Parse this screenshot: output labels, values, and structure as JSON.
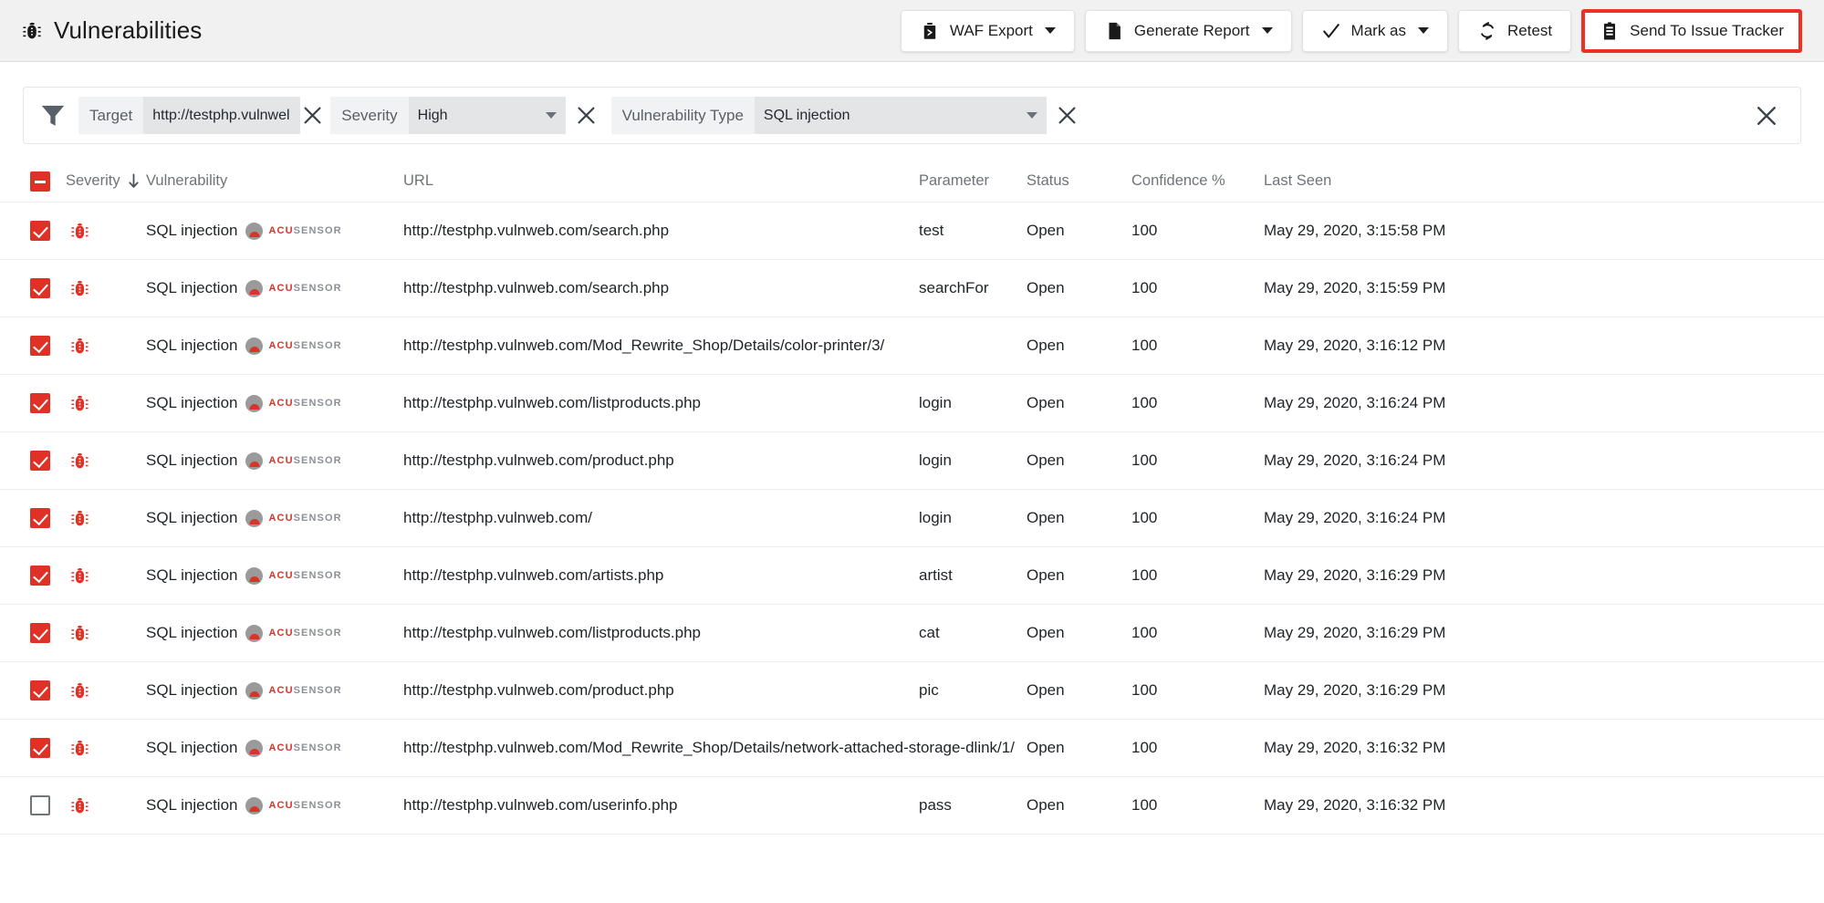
{
  "header": {
    "title": "Vulnerabilities",
    "bug_icon": "bug-icon",
    "toolbar": [
      {
        "label": "WAF Export",
        "icon": "waf-export-icon",
        "has_caret": true,
        "highlighted": false
      },
      {
        "label": "Generate Report",
        "icon": "document-icon",
        "has_caret": true,
        "highlighted": false
      },
      {
        "label": "Mark as",
        "icon": "check-icon",
        "has_caret": true,
        "highlighted": false
      },
      {
        "label": "Retest",
        "icon": "refresh-icon",
        "has_caret": false,
        "highlighted": false
      },
      {
        "label": "Send To Issue Tracker",
        "icon": "clipboard-icon",
        "has_caret": false,
        "highlighted": true
      }
    ],
    "highlight_color": "#ee3124"
  },
  "filters": {
    "funnel_icon": "filter-funnel-icon",
    "items": [
      {
        "label": "Target",
        "value": "http://testphp.vulnwel",
        "type": "text",
        "clearable": true
      },
      {
        "label": "Severity",
        "value": "High",
        "type": "select",
        "clearable": true
      },
      {
        "label": "Vulnerability Type",
        "value": "SQL injection",
        "type": "select",
        "clearable": true
      }
    ],
    "clear_all_icon": "close-icon"
  },
  "table": {
    "select_all_state": "indeterminate",
    "columns": [
      {
        "key": "severity",
        "label": "Severity",
        "sorted": true,
        "sort_dir": "down"
      },
      {
        "key": "vulnerability",
        "label": "Vulnerability"
      },
      {
        "key": "url",
        "label": "URL"
      },
      {
        "key": "parameter",
        "label": "Parameter"
      },
      {
        "key": "status",
        "label": "Status"
      },
      {
        "key": "confidence",
        "label": "Confidence %"
      },
      {
        "key": "last_seen",
        "label": "Last Seen"
      }
    ],
    "rows": [
      {
        "checked": true,
        "severity_icon": "high-severity-bug-icon",
        "vulnerability": "SQL injection",
        "acusensor": true,
        "url": "http://testphp.vulnweb.com/search.php",
        "parameter": "test",
        "status": "Open",
        "confidence": "100",
        "last_seen": "May 29, 2020, 3:15:58 PM"
      },
      {
        "checked": true,
        "severity_icon": "high-severity-bug-icon",
        "vulnerability": "SQL injection",
        "acusensor": true,
        "url": "http://testphp.vulnweb.com/search.php",
        "parameter": "searchFor",
        "status": "Open",
        "confidence": "100",
        "last_seen": "May 29, 2020, 3:15:59 PM"
      },
      {
        "checked": true,
        "severity_icon": "high-severity-bug-icon",
        "vulnerability": "SQL injection",
        "acusensor": true,
        "url": "http://testphp.vulnweb.com/Mod_Rewrite_Shop/Details/color-printer/3/",
        "parameter": "",
        "status": "Open",
        "confidence": "100",
        "last_seen": "May 29, 2020, 3:16:12 PM"
      },
      {
        "checked": true,
        "severity_icon": "high-severity-bug-icon",
        "vulnerability": "SQL injection",
        "acusensor": true,
        "url": "http://testphp.vulnweb.com/listproducts.php",
        "parameter": "login",
        "status": "Open",
        "confidence": "100",
        "last_seen": "May 29, 2020, 3:16:24 PM"
      },
      {
        "checked": true,
        "severity_icon": "high-severity-bug-icon",
        "vulnerability": "SQL injection",
        "acusensor": true,
        "url": "http://testphp.vulnweb.com/product.php",
        "parameter": "login",
        "status": "Open",
        "confidence": "100",
        "last_seen": "May 29, 2020, 3:16:24 PM"
      },
      {
        "checked": true,
        "severity_icon": "high-severity-bug-icon",
        "vulnerability": "SQL injection",
        "acusensor": true,
        "url": "http://testphp.vulnweb.com/",
        "parameter": "login",
        "status": "Open",
        "confidence": "100",
        "last_seen": "May 29, 2020, 3:16:24 PM"
      },
      {
        "checked": true,
        "severity_icon": "high-severity-bug-icon",
        "vulnerability": "SQL injection",
        "acusensor": true,
        "url": "http://testphp.vulnweb.com/artists.php",
        "parameter": "artist",
        "status": "Open",
        "confidence": "100",
        "last_seen": "May 29, 2020, 3:16:29 PM"
      },
      {
        "checked": true,
        "severity_icon": "high-severity-bug-icon",
        "vulnerability": "SQL injection",
        "acusensor": true,
        "url": "http://testphp.vulnweb.com/listproducts.php",
        "parameter": "cat",
        "status": "Open",
        "confidence": "100",
        "last_seen": "May 29, 2020, 3:16:29 PM"
      },
      {
        "checked": true,
        "severity_icon": "high-severity-bug-icon",
        "vulnerability": "SQL injection",
        "acusensor": true,
        "url": "http://testphp.vulnweb.com/product.php",
        "parameter": "pic",
        "status": "Open",
        "confidence": "100",
        "last_seen": "May 29, 2020, 3:16:29 PM"
      },
      {
        "checked": true,
        "severity_icon": "high-severity-bug-icon",
        "vulnerability": "SQL injection",
        "acusensor": true,
        "url": "http://testphp.vulnweb.com/Mod_Rewrite_Shop/Details/network-attached-storage-dlink/1/",
        "parameter": "",
        "status": "Open",
        "confidence": "100",
        "last_seen": "May 29, 2020, 3:16:32 PM"
      },
      {
        "checked": false,
        "severity_icon": "high-severity-bug-icon",
        "vulnerability": "SQL injection",
        "acusensor": true,
        "url": "http://testphp.vulnweb.com/userinfo.php",
        "parameter": "pass",
        "status": "Open",
        "confidence": "100",
        "last_seen": "May 29, 2020, 3:16:32 PM"
      }
    ],
    "acusensor_badge": {
      "text_red": "ACU",
      "text_gray": "SENSOR"
    }
  },
  "colors": {
    "severity_red": "#e03127",
    "highlight_red": "#ee3124",
    "header_bg": "#f1f1f1"
  }
}
